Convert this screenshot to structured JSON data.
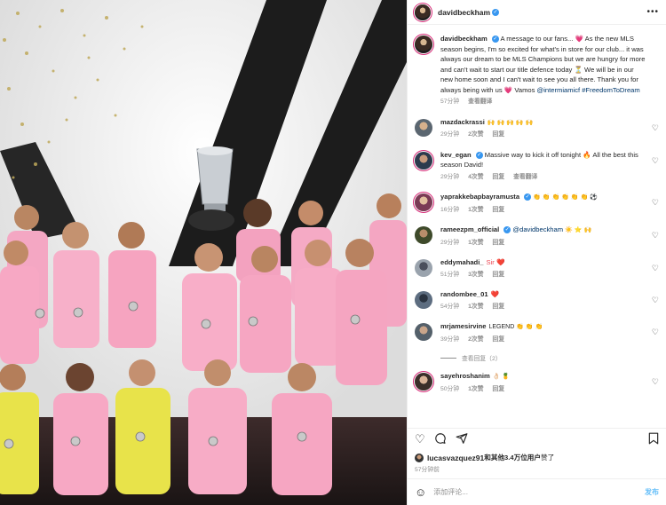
{
  "post": {
    "username": "davidbeckham",
    "caption_parts": [
      "A message to our fans... ",
      "💗",
      " As the new MLS season begins, I'm so excited for what's in store for our club... it was always our dream to be MLS Champions but we are hungry for more and can't wait to start our title defence today ",
      "⏳",
      " We will be in our new home soon and I can't wait to see you all there. Thank you for always being with us ",
      "💗",
      " Vamos "
    ],
    "caption_mention": "@intermiamicf",
    "caption_tag": "#FreedomToDream",
    "caption_time": "57分钟",
    "caption_translate": "查看翻译"
  },
  "comments": [
    {
      "username": "mazdackrassi",
      "verified": false,
      "text": "🙌 🙌 🙌 🙌 🙌",
      "time": "29分钟",
      "likes": "2次赞",
      "reply": "回复",
      "translate": ""
    },
    {
      "username": "kev_egan",
      "verified": true,
      "text": "Massive way to kick it off tonight 🔥 All the best this season David!",
      "time": "29分钟",
      "likes": "4次赞",
      "reply": "回复",
      "translate": "查看翻译"
    },
    {
      "username": "yaprakkebapbayramusta",
      "verified": true,
      "text": "👏 👏 👏 👏 👏 👏 ⚽",
      "time": "16分钟",
      "likes": "1次赞",
      "reply": "回复",
      "translate": ""
    },
    {
      "username": "rameezpm_official",
      "verified": true,
      "mention": "@davidbeckham",
      "text": "☀️ ⭐ 🙌",
      "time": "29分钟",
      "likes": "1次赞",
      "reply": "回复",
      "translate": ""
    },
    {
      "username": "eddymahadi_",
      "verified": false,
      "text": "Sir ❤️",
      "time": "51分钟",
      "likes": "3次赞",
      "reply": "回复",
      "translate": ""
    },
    {
      "username": "randombee_01",
      "verified": false,
      "text": "❤️",
      "time": "54分钟",
      "likes": "1次赞",
      "reply": "回复",
      "translate": ""
    },
    {
      "username": "mrjamesirvine",
      "verified": false,
      "text": "LEGEND 👏 👏 👏",
      "time": "39分钟",
      "likes": "2次赞",
      "reply": "回复",
      "translate": ""
    },
    {
      "username": "sayehroshanim",
      "verified": false,
      "text": "👌🏻 🍍",
      "time": "50分钟",
      "likes": "1次赞",
      "reply": "回复",
      "translate": ""
    }
  ],
  "view_replies": "查看回复（2）",
  "likes": {
    "user": "lucasvazquez91",
    "text": "和其他3.4万位用户",
    "suffix": "赞了",
    "time": "57分钟前"
  },
  "comment_input": {
    "placeholder": "添加评论...",
    "post_label": "发布"
  },
  "colors": {
    "accent": "#0095f6",
    "jersey_pink": "#f7a8c4",
    "gk_yellow": "#e8e34a",
    "verified": "#3897f0"
  },
  "icons": [
    "heart-icon",
    "comment-icon",
    "share-icon",
    "bookmark-icon",
    "smile-icon",
    "more-icon",
    "verified-icon",
    "trophy-icon"
  ]
}
